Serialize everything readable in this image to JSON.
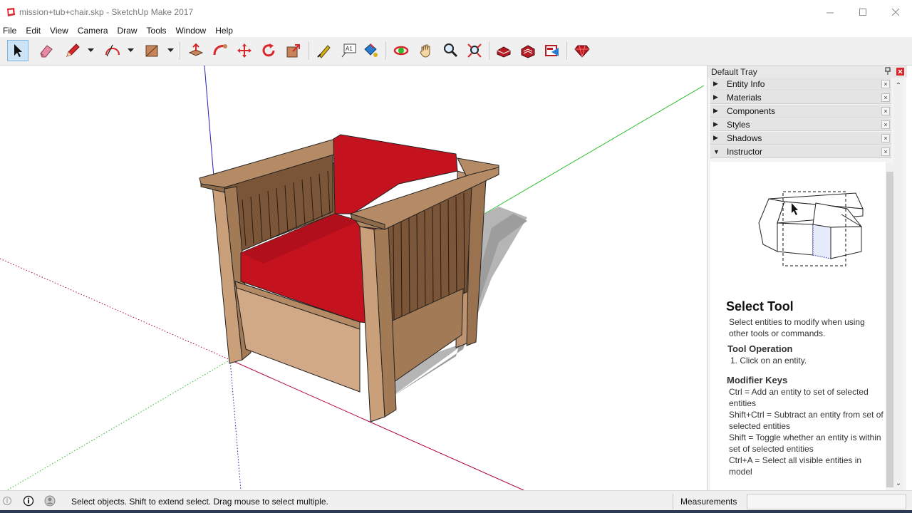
{
  "window": {
    "title": "mission+tub+chair.skp - SketchUp Make 2017",
    "minimize_icon": "minimize-icon",
    "maximize_icon": "maximize-icon",
    "close_icon": "close-icon"
  },
  "menu": [
    "File",
    "Edit",
    "View",
    "Camera",
    "Draw",
    "Tools",
    "Window",
    "Help"
  ],
  "toolbar": {
    "tools": [
      "select-tool",
      "eraser-tool",
      "line-tool",
      "arc-tool",
      "rectangle-tool",
      "push-pull-tool",
      "follow-me-tool",
      "move-tool",
      "rotate-tool",
      "scale-tool",
      "tape-measure-tool",
      "text-tool",
      "paint-bucket-tool",
      "orbit-tool",
      "pan-tool",
      "zoom-tool",
      "zoom-extents-tool",
      "warehouse-tool",
      "extension-warehouse-tool",
      "layout-tool",
      "ruby-tool"
    ],
    "text_tool_label": "A1",
    "accent": "#cde4f7"
  },
  "tray": {
    "title": "Default Tray",
    "panels": [
      {
        "label": "Entity Info",
        "expanded": false
      },
      {
        "label": "Materials",
        "expanded": false
      },
      {
        "label": "Components",
        "expanded": false
      },
      {
        "label": "Styles",
        "expanded": false
      },
      {
        "label": "Shadows",
        "expanded": false
      },
      {
        "label": "Instructor",
        "expanded": true
      }
    ]
  },
  "instructor": {
    "title": "Select Tool",
    "description": "Select entities to modify when using other tools or commands.",
    "operation_heading": "Tool Operation",
    "operation_steps": [
      "1. Click on an entity."
    ],
    "modifier_heading": "Modifier Keys",
    "modifiers": [
      "Ctrl = Add an entity to set of selected entities",
      "Shift+Ctrl = Subtract an entity from set of selected entities",
      "Shift = Toggle whether an entity is within set of selected entities",
      "Ctrl+A = Select all visible entities in model"
    ]
  },
  "status": {
    "message": "Select objects. Shift to extend select. Drag mouse to select multiple.",
    "measurements_label": "Measurements",
    "measurements_value": ""
  },
  "colors": {
    "cushion_red": "#c5121f",
    "wood": "#c9a07a",
    "axis_red": "#b0003a",
    "axis_green": "#2bbd2b",
    "axis_blue": "#2020b0"
  }
}
